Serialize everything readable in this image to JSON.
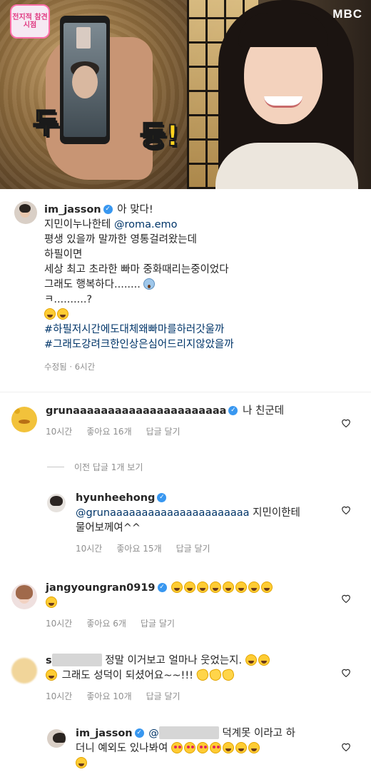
{
  "media": {
    "broadcaster_logo": "MBC",
    "show_logo": "전지적 참견시점",
    "caption_left": "두",
    "caption_right": "둥!"
  },
  "post": {
    "username": "im_jasson",
    "lines": [
      "아 맞다!",
      "지민이누나한테",
      "@roma.emo",
      "평생 있을까 말까한 영통걸려왔는데",
      "하필이면",
      "세상 최고 초라한 빠마 중화때리는중이었다",
      "그래도 행복하다........",
      "ㅋ..........?"
    ],
    "hashtags": [
      "#하필저시간에도대체왜빠마를하러갓울까",
      "#그래도강려크한인상은심어드리지않았을까"
    ],
    "meta": "수정됨 · 6시간"
  },
  "comments": [
    {
      "username": "grunaaaaaaaaaaaaaaaaaaaaaa",
      "text": "나 친군데",
      "time": "10시간",
      "likes": "좋아요 16개",
      "reply": "답글 달기"
    }
  ],
  "view_replies": "이전 답글 1개 보기",
  "reply1": {
    "username": "hyunheehong",
    "mention": "@grunaaaaaaaaaaaaaaaaaaaaaa",
    "text1": "지민이한테",
    "text2": "물어보께여^^",
    "time": "10시간",
    "likes": "좋아요 15개",
    "reply": "답글 달기"
  },
  "comment2": {
    "username": "jangyoungran0919",
    "time": "10시간",
    "likes": "좋아요 6개",
    "reply": "답글 달기"
  },
  "comment3": {
    "username_prefix": "s",
    "text1": "정말 이거보고 얼마나 웃었는지.",
    "text2": "그래도 성덕이 되셨어요~~!!!",
    "time": "10시간",
    "likes": "좋아요 10개",
    "reply": "답글 달기"
  },
  "reply2": {
    "username": "im_jasson",
    "mention": "@",
    "text1": "덕계못 이라고 하",
    "text2": "더니 예외도 있나봐여"
  },
  "colors": {
    "link": "#003569",
    "verified": "#3897f0",
    "meta": "#8e8e8e",
    "text": "#262626"
  }
}
